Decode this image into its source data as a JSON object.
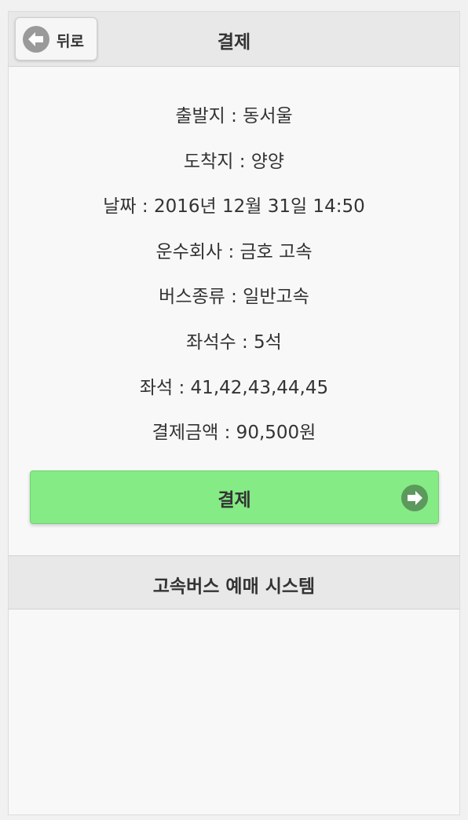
{
  "header": {
    "back_label": "뒤로",
    "title": "결제"
  },
  "info": {
    "departure": "출발지 : 동서울",
    "arrival": "도착지 : 양양",
    "date": "날짜 : 2016년 12월 31일 14:50",
    "company": "운수회사 : 금호 고속",
    "bus_type": "버스종류 : 일반고속",
    "seat_count": "좌석수 : 5석",
    "seats": "좌석 : 41,42,43,44,45",
    "amount": "결제금액 : 90,500원"
  },
  "pay_button": {
    "label": "결제"
  },
  "footer": {
    "title": "고속버스 예매 시스템"
  },
  "icons": {
    "back": "arrow-left-circle-icon",
    "pay": "arrow-right-circle-icon"
  },
  "colors": {
    "header_bg": "#e8e8e8",
    "pay_button_bg": "#85eb85",
    "icon_gray": "#9a9a9a",
    "icon_green": "#5c995c"
  }
}
